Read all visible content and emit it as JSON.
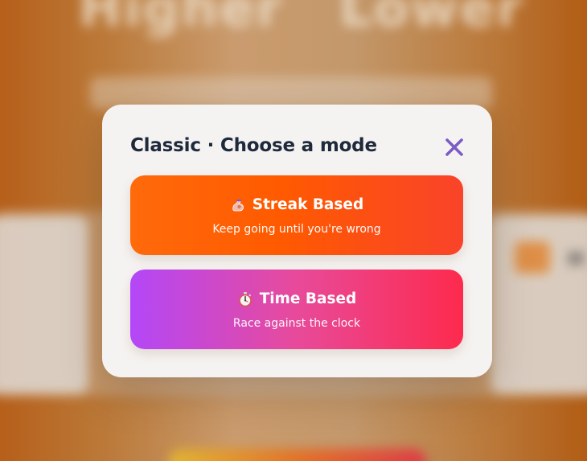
{
  "background": {
    "title_words": [
      "Higher",
      "Lower"
    ],
    "right_glyph": "H"
  },
  "modal": {
    "title": "Classic · Choose a mode",
    "close_icon": "close-x-icon",
    "modes": [
      {
        "label": "Streak Based",
        "description": "Keep going until you're wrong",
        "icon": "flexed-biceps-icon",
        "gradient": [
          "#ff6a0b",
          "#f9432a"
        ]
      },
      {
        "label": "Time Based",
        "description": "Race against the clock",
        "icon": "stopwatch-icon",
        "gradient": [
          "#b347f8",
          "#fd2a4d"
        ]
      }
    ]
  },
  "colors": {
    "title": "#1e293b",
    "close_icon": "#7c5cc4",
    "modal_bg": "#f5f3f2"
  }
}
